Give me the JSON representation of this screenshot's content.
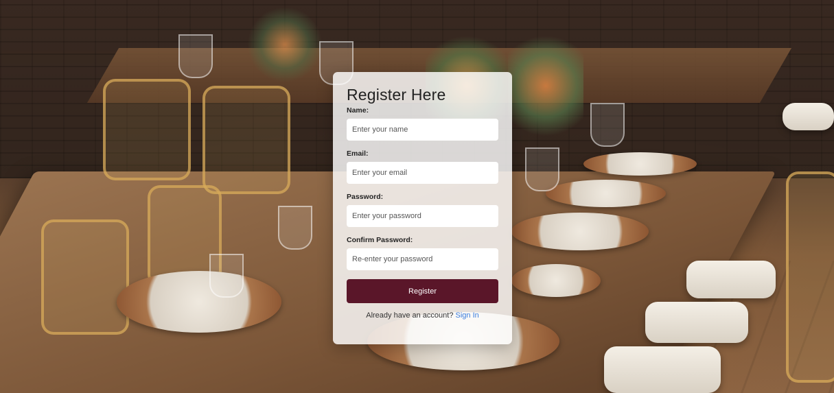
{
  "form": {
    "title": "Register Here",
    "fields": [
      {
        "label": "Name:",
        "placeholder": "Enter your name",
        "type": "text"
      },
      {
        "label": "Email:",
        "placeholder": "Enter your email",
        "type": "email"
      },
      {
        "label": "Password:",
        "placeholder": "Enter your password",
        "type": "password"
      },
      {
        "label": "Confirm Password:",
        "placeholder": "Re-enter your password",
        "type": "password"
      }
    ],
    "submit_label": "Register",
    "signin_prompt": "Already have an account?",
    "signin_link": "Sign In",
    "accent_color": "#5a1629",
    "link_color": "#3b7ddd"
  }
}
